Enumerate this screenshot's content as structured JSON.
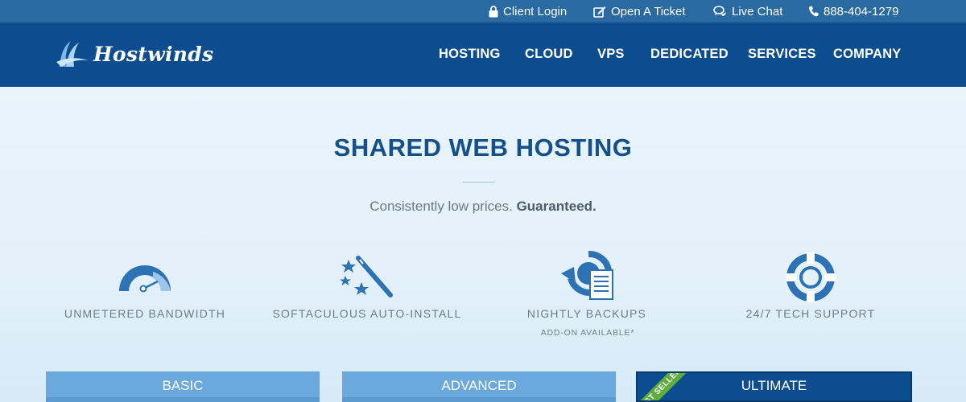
{
  "utility": {
    "client_login": "Client Login",
    "open_ticket": "Open A Ticket",
    "live_chat": "Live Chat",
    "phone": "888-404-1279"
  },
  "logo": {
    "text": "Hostwinds"
  },
  "nav": [
    "HOSTING",
    "CLOUD",
    "VPS",
    "DEDICATED",
    "SERVICES",
    "COMPANY"
  ],
  "hero": {
    "title": "SHARED WEB HOSTING",
    "tagline_plain": "Consistently low prices.",
    "tagline_bold": "Guaranteed."
  },
  "features": [
    {
      "label": "UNMETERED BANDWIDTH",
      "icon": "speedometer-icon"
    },
    {
      "label": "SOFTACULOUS AUTO-INSTALL",
      "icon": "magic-wand-icon"
    },
    {
      "label": "NIGHTLY BACKUPS",
      "sub": "ADD-ON AVAILABLE*",
      "icon": "backup-icon"
    },
    {
      "label": "24/7 TECH SUPPORT",
      "icon": "lifebuoy-icon"
    }
  ],
  "plans": [
    {
      "name": "BASIC"
    },
    {
      "name": "ADVANCED"
    },
    {
      "name": "ULTIMATE",
      "ribbon": "BEST SELLER"
    }
  ],
  "colors": {
    "utility_bar": "#2a6aa3",
    "nav": "#0b4d8f",
    "title": "#15508a",
    "icon": "#2c72b5",
    "tab": "#6aa8dd",
    "ribbon": "#5fae3d"
  }
}
